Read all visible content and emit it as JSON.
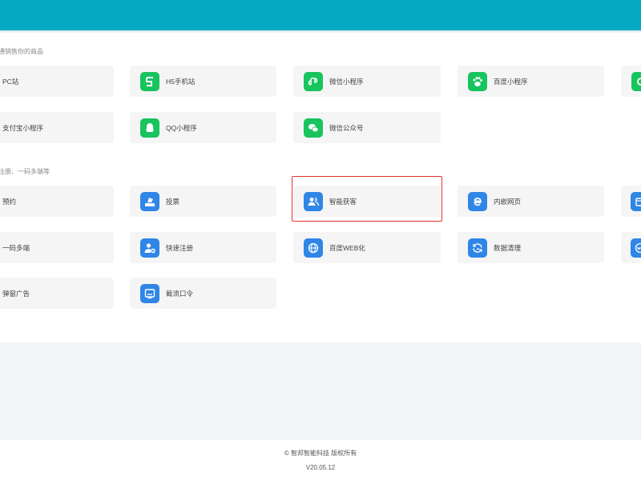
{
  "colors": {
    "header": "#06a9c4",
    "icon_green": "#17c45e",
    "icon_blue": "#2f86e6",
    "highlight_border": "#e8312d"
  },
  "sections": [
    {
      "title": "通销售你的商品",
      "items": [
        {
          "label": "PC站",
          "icon": "none"
        },
        {
          "label": "H5手机站",
          "icon": "html5-icon"
        },
        {
          "label": "微信小程序",
          "icon": "wechat-miniprogram-icon"
        },
        {
          "label": "百度小程序",
          "icon": "baidu-paw-icon"
        },
        {
          "label": "",
          "icon": "miniprogram-icon"
        },
        {
          "label": "支付宝小程序",
          "icon": "none"
        },
        {
          "label": "QQ小程序",
          "icon": "qq-icon"
        },
        {
          "label": "微信公众号",
          "icon": "wechat-icon"
        }
      ]
    },
    {
      "title": "注册、一码多端等",
      "items": [
        {
          "label": "预约",
          "icon": "none"
        },
        {
          "label": "投票",
          "icon": "vote-icon"
        },
        {
          "label": "智能获客",
          "icon": "users-icon",
          "highlighted": true
        },
        {
          "label": "内嵌网页",
          "icon": "browser-e-icon"
        },
        {
          "label": "",
          "icon": "calendar-icon"
        },
        {
          "label": "一码多端",
          "icon": "none"
        },
        {
          "label": "快速注册",
          "icon": "user-add-icon"
        },
        {
          "label": "百度WEB化",
          "icon": "globe-icon"
        },
        {
          "label": "数据清理",
          "icon": "refresh-clean-icon"
        },
        {
          "label": "",
          "icon": "web-icon"
        },
        {
          "label": "弹窗广告",
          "icon": "none"
        },
        {
          "label": "截流口令",
          "icon": "command-icon"
        }
      ]
    }
  ],
  "footer": {
    "copyright": "© 智邦智能科技 版权所有",
    "version": "V20.05.12"
  }
}
